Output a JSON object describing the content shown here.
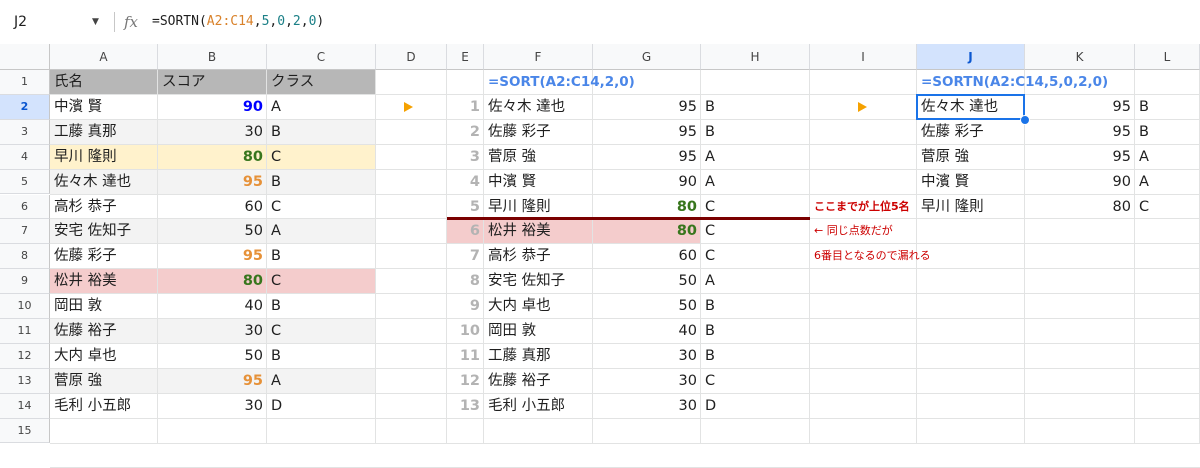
{
  "formula_bar": {
    "cell_ref": "J2",
    "fx": "fx",
    "formula_prefix": "=SORTN(",
    "formula_range": "A2:C14",
    "formula_args": [
      ",",
      "5",
      ",",
      "0",
      ",",
      "2",
      ",",
      "0"
    ],
    "formula_suffix": ")"
  },
  "columns": [
    "A",
    "B",
    "C",
    "D",
    "E",
    "F",
    "G",
    "H",
    "I",
    "J",
    "K",
    "L"
  ],
  "rows": [
    "1",
    "2",
    "3",
    "4",
    "5",
    "6",
    "7",
    "8",
    "9",
    "10",
    "11",
    "12",
    "13",
    "14",
    "15"
  ],
  "headers": {
    "name": "氏名",
    "score": "スコア",
    "class": "クラス"
  },
  "source": [
    {
      "name": "中濱 賢",
      "score": "90",
      "cls": "A"
    },
    {
      "name": "工藤 真那",
      "score": "30",
      "cls": "B"
    },
    {
      "name": "早川 隆則",
      "score": "80",
      "cls": "C"
    },
    {
      "name": "佐々木 達也",
      "score": "95",
      "cls": "B"
    },
    {
      "name": "高杉 恭子",
      "score": "60",
      "cls": "C"
    },
    {
      "name": "安宅 佐知子",
      "score": "50",
      "cls": "A"
    },
    {
      "name": "佐藤 彩子",
      "score": "95",
      "cls": "B"
    },
    {
      "name": "松井 裕美",
      "score": "80",
      "cls": "C"
    },
    {
      "name": "岡田 敦",
      "score": "40",
      "cls": "B"
    },
    {
      "name": "佐藤 裕子",
      "score": "30",
      "cls": "C"
    },
    {
      "name": "大内 卓也",
      "score": "50",
      "cls": "B"
    },
    {
      "name": "菅原 強",
      "score": "95",
      "cls": "A"
    },
    {
      "name": "毛利 小五郎",
      "score": "30",
      "cls": "D"
    }
  ],
  "sort_label": "=SORT(A2:C14,2,0)",
  "sorted": [
    {
      "idx": "1",
      "name": "佐々木 達也",
      "score": "95",
      "cls": "B"
    },
    {
      "idx": "2",
      "name": "佐藤 彩子",
      "score": "95",
      "cls": "B"
    },
    {
      "idx": "3",
      "name": "菅原 強",
      "score": "95",
      "cls": "A"
    },
    {
      "idx": "4",
      "name": "中濱 賢",
      "score": "90",
      "cls": "A"
    },
    {
      "idx": "5",
      "name": "早川 隆則",
      "score": "80",
      "cls": "C"
    },
    {
      "idx": "6",
      "name": "松井 裕美",
      "score": "80",
      "cls": "C"
    },
    {
      "idx": "7",
      "name": "高杉 恭子",
      "score": "60",
      "cls": "C"
    },
    {
      "idx": "8",
      "name": "安宅 佐知子",
      "score": "50",
      "cls": "A"
    },
    {
      "idx": "9",
      "name": "大内 卓也",
      "score": "50",
      "cls": "B"
    },
    {
      "idx": "10",
      "name": "岡田 敦",
      "score": "40",
      "cls": "B"
    },
    {
      "idx": "11",
      "name": "工藤 真那",
      "score": "30",
      "cls": "B"
    },
    {
      "idx": "12",
      "name": "佐藤 裕子",
      "score": "30",
      "cls": "C"
    },
    {
      "idx": "13",
      "name": "毛利 小五郎",
      "score": "30",
      "cls": "D"
    }
  ],
  "notes": {
    "top5": "ここまでが上位5名",
    "same_score": "← 同じ点数だが",
    "sixth": "6番目となるので漏れる"
  },
  "sortn_label": "=SORTN(A2:C14,5,0,2,0)",
  "sortn": [
    {
      "name": "佐々木 達也",
      "score": "95",
      "cls": "B"
    },
    {
      "name": "佐藤 彩子",
      "score": "95",
      "cls": "B"
    },
    {
      "name": "菅原 強",
      "score": "95",
      "cls": "A"
    },
    {
      "name": "中濱 賢",
      "score": "90",
      "cls": "A"
    },
    {
      "name": "早川 隆則",
      "score": "80",
      "cls": "C"
    }
  ],
  "colors": {
    "header_gray": "#b7b7b7",
    "highlight_yellow": "#fff2cc",
    "highlight_pink": "#f4cccc",
    "band_gray": "#f3f3f3",
    "score_blue": "#0000ff",
    "score_orange": "#e69138",
    "score_green": "#38761d",
    "arrow_orange": "#f5a100",
    "selection_blue": "#1a73e8"
  }
}
